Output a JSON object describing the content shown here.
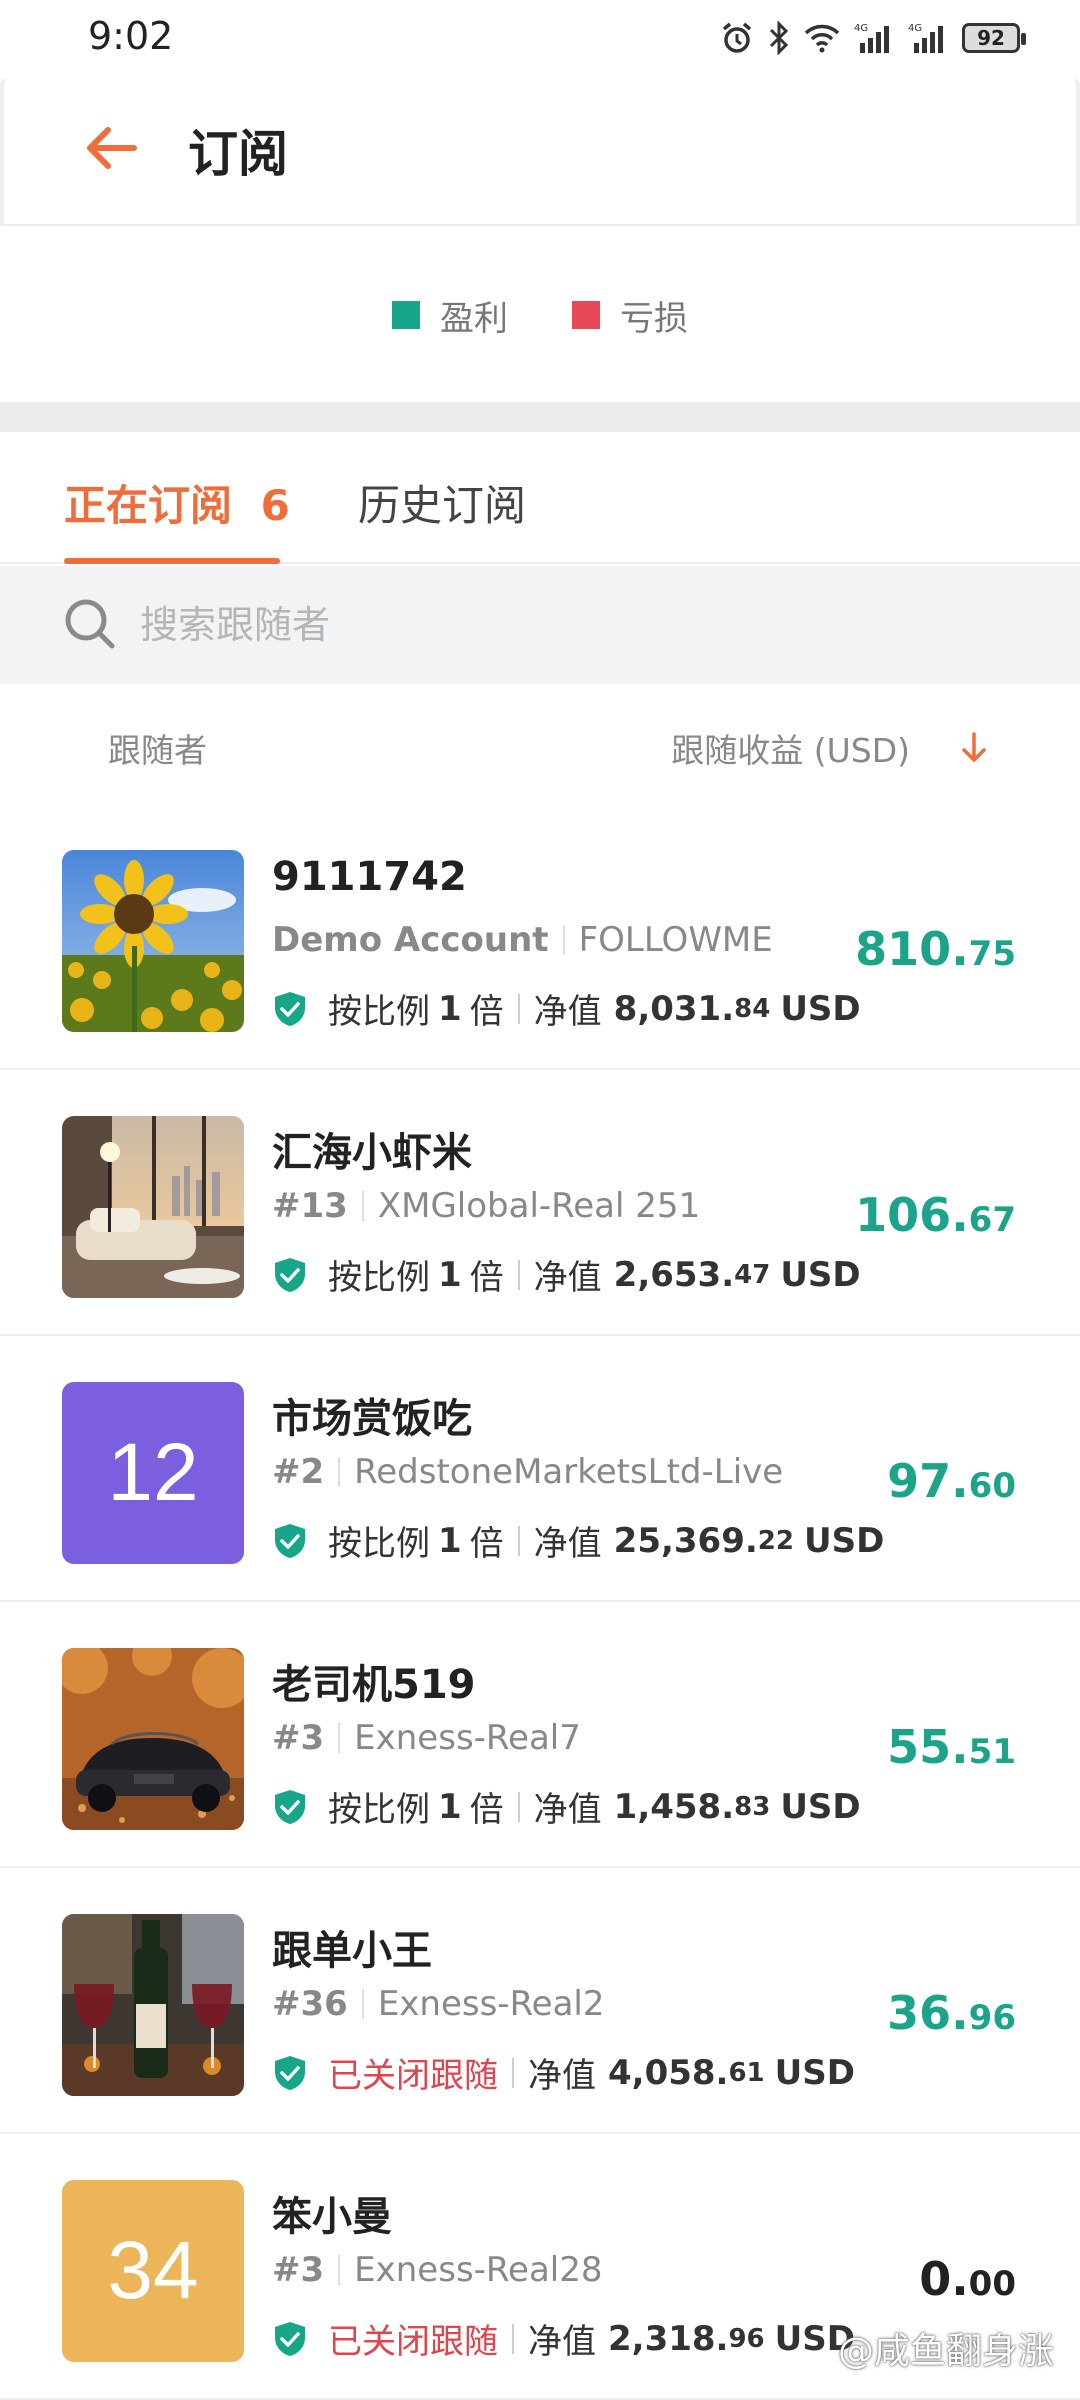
{
  "status_bar": {
    "time": "9:02",
    "battery": "92",
    "signal1": "4G",
    "signal2": "4G"
  },
  "header": {
    "title": "订阅"
  },
  "legend": [
    {
      "label": "盈利",
      "color": "#17a689"
    },
    {
      "label": "亏损",
      "color": "#e8485a"
    }
  ],
  "tabs": {
    "active_label": "正在订阅",
    "active_count": "6",
    "inactive_label": "历史订阅"
  },
  "search": {
    "placeholder": "搜索跟随者"
  },
  "columns": {
    "left": "跟随者",
    "right": "跟随收益 (USD)"
  },
  "followers": [
    {
      "name": "9111742",
      "account": "Demo Account",
      "server": "FOLLOWME",
      "status": "按比例",
      "ratio": "1",
      "ratio_unit": "倍",
      "status_type": "normal",
      "equity_label": "净值",
      "equity_int": "8,031.",
      "equity_dec": "84",
      "currency": "USD",
      "profit_int": "810.",
      "profit_dec": "75",
      "avatar": {
        "type": "image",
        "scene": "sunflower"
      }
    },
    {
      "name": "汇海小虾米",
      "account": "#13",
      "server": "XMGlobal-Real 251",
      "status": "按比例",
      "ratio": "1",
      "ratio_unit": "倍",
      "status_type": "normal",
      "equity_label": "净值",
      "equity_int": "2,653.",
      "equity_dec": "47",
      "currency": "USD",
      "profit_int": "106.",
      "profit_dec": "67",
      "avatar": {
        "type": "image",
        "scene": "room"
      }
    },
    {
      "name": "市场赏饭吃",
      "account": "#2",
      "server": "RedstoneMarketsLtd-Live",
      "status": "按比例",
      "ratio": "1",
      "ratio_unit": "倍",
      "status_type": "normal",
      "equity_label": "净值",
      "equity_int": "25,369.",
      "equity_dec": "22",
      "currency": "USD",
      "profit_int": "97.",
      "profit_dec": "60",
      "avatar": {
        "type": "number",
        "text": "12",
        "color": "#7b5fde"
      }
    },
    {
      "name": "老司机519",
      "account": "#3",
      "server": "Exness-Real7",
      "status": "按比例",
      "ratio": "1",
      "ratio_unit": "倍",
      "status_type": "normal",
      "equity_label": "净值",
      "equity_int": "1,458.",
      "equity_dec": "83",
      "currency": "USD",
      "profit_int": "55.",
      "profit_dec": "51",
      "avatar": {
        "type": "image",
        "scene": "car"
      }
    },
    {
      "name": "跟单小王",
      "account": "#36",
      "server": "Exness-Real2",
      "status": "已关闭跟随",
      "ratio": "",
      "ratio_unit": "",
      "status_type": "closed",
      "equity_label": "净值",
      "equity_int": "4,058.",
      "equity_dec": "61",
      "currency": "USD",
      "profit_int": "36.",
      "profit_dec": "96",
      "avatar": {
        "type": "image",
        "scene": "wine"
      }
    },
    {
      "name": "笨小曼",
      "account": "#3",
      "server": "Exness-Real28",
      "status": "已关闭跟随",
      "ratio": "",
      "ratio_unit": "",
      "status_type": "closed",
      "equity_label": "净值",
      "equity_int": "2,318.",
      "equity_dec": "96",
      "currency": "USD",
      "profit_int": "0.",
      "profit_dec": "00",
      "avatar": {
        "type": "number",
        "text": "34",
        "color": "#ecb55a"
      }
    }
  ],
  "watermark": "@咸鱼翻身涨"
}
